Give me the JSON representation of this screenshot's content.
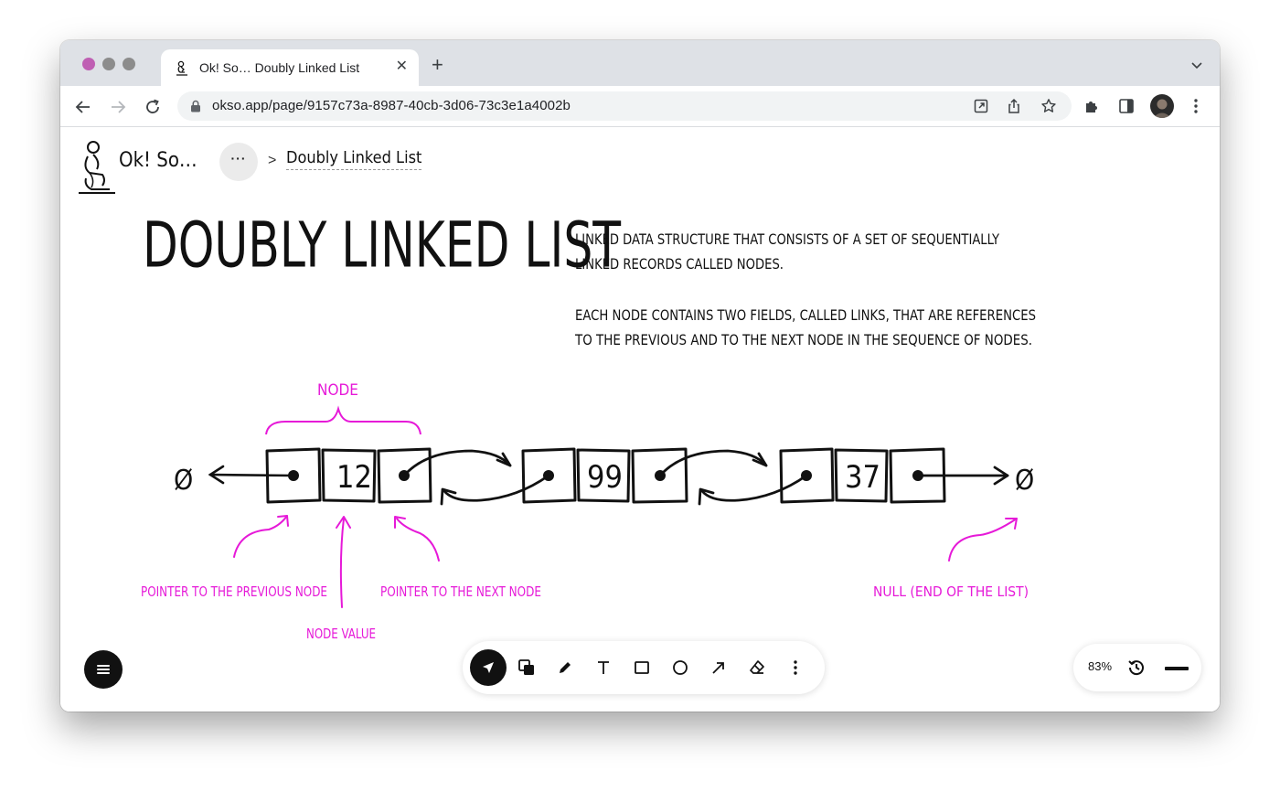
{
  "browser": {
    "tab_title": "Ok! So… Doubly Linked List",
    "url": "okso.app/page/9157c73a-8987-40cb-3d06-73c3e1a4002b",
    "traffic_light_colors": [
      "#bf5fb3",
      "#8c8c8c",
      "#8c8c8c"
    ]
  },
  "app": {
    "brand": "Ok! So…",
    "more_label": "···",
    "breadcrumb_separator": ">",
    "breadcrumb": "Doubly Linked List"
  },
  "sketch": {
    "heading": "DOUBLY LINKED LIST",
    "description_1_line1": "LINKED DATA STRUCTURE THAT CONSISTS OF A SET OF SEQUENTIALLY",
    "description_1_line2": "LINKED RECORDS CALLED NODES.",
    "description_2_line1": "EACH NODE CONTAINS TWO FIELDS, CALLED LINKS, THAT ARE REFERENCES",
    "description_2_line2": "TO THE PREVIOUS AND TO THE NEXT NODE IN THE SEQUENCE OF NODES.",
    "node_label": "NODE",
    "nodes": [
      "12",
      "99",
      "37"
    ],
    "null_symbol": "Ø",
    "annotation_prev": "POINTER TO THE PREVIOUS NODE",
    "annotation_value": "NODE VALUE",
    "annotation_next": "POINTER TO THE NEXT NODE",
    "annotation_null": "NULL (END OF THE LIST)",
    "ink_color": "#111111",
    "annotation_color": "#e619d8"
  },
  "controls": {
    "zoom": "83%",
    "tools": [
      "pointer-tool",
      "layers-tool",
      "pen-tool",
      "text-tool",
      "rectangle-tool",
      "circle-tool",
      "arrow-tool",
      "eraser-tool",
      "more-tools"
    ]
  }
}
